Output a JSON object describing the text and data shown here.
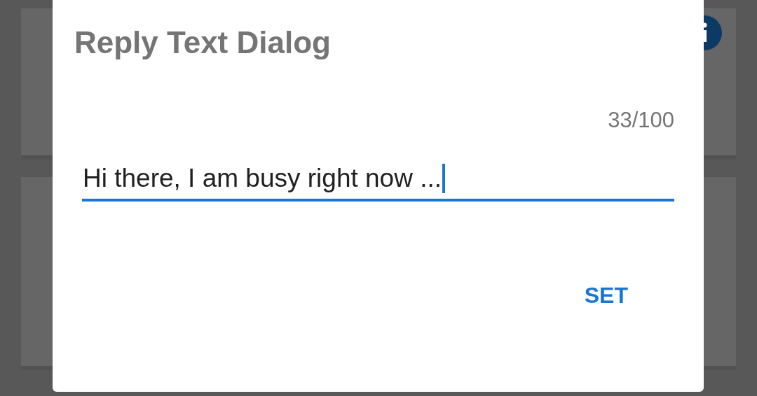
{
  "dialog": {
    "title": "Reply Text Dialog",
    "counter": "33/100",
    "field": {
      "value": "Hi there, I am busy right now ...",
      "focused": true
    },
    "buttons": [
      {
        "label": "SET"
      }
    ]
  }
}
